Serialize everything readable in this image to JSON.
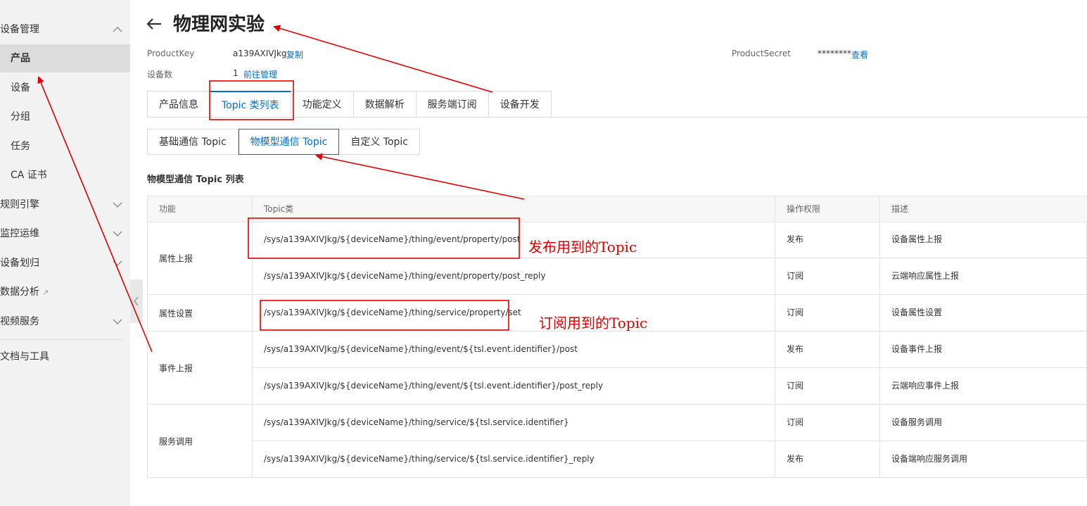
{
  "sidebar": {
    "items": [
      {
        "label": "设备管理",
        "type": "top",
        "chevron": "chevron-up-icon"
      },
      {
        "label": "产品",
        "type": "child",
        "active": true
      },
      {
        "label": "设备",
        "type": "child"
      },
      {
        "label": "分组",
        "type": "child"
      },
      {
        "label": "任务",
        "type": "child"
      },
      {
        "label": "CA 证书",
        "type": "child"
      },
      {
        "label": "规则引擎",
        "type": "top",
        "chevron": "chevron-down-icon"
      },
      {
        "label": "监控运维",
        "type": "top",
        "chevron": "chevron-down-icon"
      },
      {
        "label": "设备划归",
        "type": "top",
        "chevron": "chevron-down-icon"
      },
      {
        "label": "数据分析",
        "type": "top",
        "external": true
      },
      {
        "label": "视频服务",
        "type": "top",
        "chevron": "chevron-down-icon"
      },
      {
        "label": "文档与工具",
        "type": "top"
      }
    ],
    "collapse_icon": "chevron-left-icon"
  },
  "header": {
    "title": "物理网实验",
    "back_icon": "arrow-left-icon",
    "product_key_label": "ProductKey",
    "product_key_value": "a139AXIVJkg",
    "copy_label": "复制",
    "product_secret_label": "ProductSecret",
    "product_secret_value": "********",
    "view_label": "查看",
    "device_count_label": "设备数",
    "device_count_value": "1",
    "manage_label": "前往管理"
  },
  "tabs": [
    {
      "label": "产品信息",
      "active": false
    },
    {
      "label": "Topic 类列表",
      "active": true
    },
    {
      "label": "功能定义",
      "active": false
    },
    {
      "label": "数据解析",
      "active": false
    },
    {
      "label": "服务端订阅",
      "active": false
    },
    {
      "label": "设备开发",
      "active": false
    }
  ],
  "subtabs": [
    {
      "label": "基础通信 Topic",
      "active": false
    },
    {
      "label": "物模型通信 Topic",
      "active": true
    },
    {
      "label": "自定义 Topic",
      "active": false
    }
  ],
  "section_title": "物模型通信 Topic 列表",
  "table": {
    "columns": [
      "功能",
      "Topic类",
      "操作权限",
      "描述"
    ],
    "groups": [
      {
        "function": "属性上报",
        "rows": [
          {
            "topic": "/sys/a139AXIVJkg/${deviceName}/thing/event/property/post",
            "permission": "发布",
            "description": "设备属性上报"
          },
          {
            "topic": "/sys/a139AXIVJkg/${deviceName}/thing/event/property/post_reply",
            "permission": "订阅",
            "description": "云端响应属性上报"
          }
        ]
      },
      {
        "function": "属性设置",
        "rows": [
          {
            "topic": "/sys/a139AXIVJkg/${deviceName}/thing/service/property/set",
            "permission": "订阅",
            "description": "设备属性设置"
          }
        ]
      },
      {
        "function": "事件上报",
        "rows": [
          {
            "topic": "/sys/a139AXIVJkg/${deviceName}/thing/event/${tsl.event.identifier}/post",
            "permission": "发布",
            "description": "设备事件上报"
          },
          {
            "topic": "/sys/a139AXIVJkg/${deviceName}/thing/event/${tsl.event.identifier}/post_reply",
            "permission": "订阅",
            "description": "云端响应事件上报"
          }
        ]
      },
      {
        "function": "服务调用",
        "rows": [
          {
            "topic": "/sys/a139AXIVJkg/${deviceName}/thing/service/${tsl.service.identifier}",
            "permission": "订阅",
            "description": "设备服务调用"
          },
          {
            "topic": "/sys/a139AXIVJkg/${deviceName}/thing/service/${tsl.service.identifier}_reply",
            "permission": "发布",
            "description": "设备端响应服务调用"
          }
        ]
      }
    ]
  },
  "annotations": {
    "publish_note": "发布用到的Topic",
    "subscribe_note": "订阅用到的Topic",
    "color": "#e00000"
  },
  "colors": {
    "accent": "#0070cc",
    "sidebar_bg": "#f2f2f2",
    "sidebar_active_bg": "#dcdcdc"
  }
}
